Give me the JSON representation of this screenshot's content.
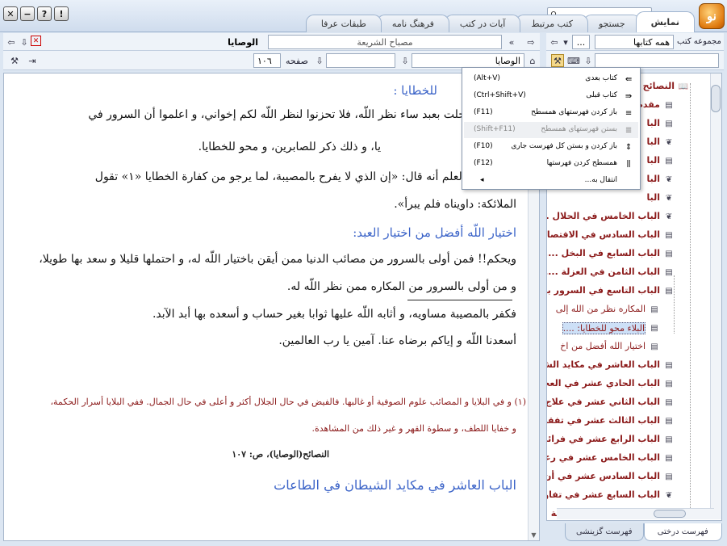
{
  "titlebar": {
    "tabs": [
      {
        "label": "نمایش",
        "active": true
      },
      {
        "label": "جستجو",
        "active": false
      },
      {
        "label": "کتب مرتبط",
        "active": false
      },
      {
        "label": "آیات در کتب",
        "active": false
      },
      {
        "label": "فرهنگ نامه",
        "active": false
      },
      {
        "label": "طبقات عرفا",
        "active": false
      }
    ],
    "logo_text": "نو"
  },
  "viewer_bar": {
    "book_title": "مصباح الشریعة",
    "section_title": "الوصايا",
    "section_field": "الوصايا",
    "page_label": "صفحه",
    "page_number": "١٠٦"
  },
  "library_bar": {
    "collection_label": "مجموعه کتب",
    "collection_value": "همه کتابها",
    "more": "..."
  },
  "text": {
    "heading_top": "للخطايا :",
    "lines": [
      "هذا مصيبة حلت بعبد ساء نظر اللّه، فلا تحزنوا لنظر اللّه لكم إخواني، و اعلموا أن السرور في",
      "يا، و ذلك ذكر للصابرين، و محو للخطايا.",
      "ن بعض أهل العلم أنه قال: «إن الذي لا يفرح بالمصيبة، لما يرجو من كفارة الخطايا «١» تقول",
      "الملائكة: داويناه فلم يبرأ»."
    ],
    "heading_2": "اختيار اللّه أفضل من اختيار العبد:",
    "lines_2": [
      "ويحكم!! فمن أولى بالسرور من مصائب الدنيا ممن أيقن باختيار اللّه له، و احتملها قليلا و سعد بها طويلا،",
      "و من أولى بالسرور من المكاره ممن نظر اللّه له.",
      "فكفر بالمصيبة مساويه، و أثابه اللّه عليها ثوابا بغير حساب و أسعده بها أبد الآبد.",
      "أسعدنا اللّه و إياكم برضاه عنا. آمين يا رب العالمين."
    ],
    "footnote_1": "(١) و في البلايا و المصائب علوم الصوفية أو غالبها. فالفيض في حال الجلال أكثر و أعلى في حال الجمال. ففي البلايا أسرار الحكمة،",
    "footnote_2": "و خفايا اللطف، و سطوة القهر و غير ذلك من المشاهدة.",
    "reference": "النصائح(الوصايا)، ص: ١٠٧",
    "next_heading": "الباب العاشر في مكايد الشيطان في الطاعات"
  },
  "context_menu": [
    {
      "label": "کتاب بعدی",
      "shortcut": "(Alt+V)",
      "icon": "book-next-icon",
      "disabled": false
    },
    {
      "label": "کتاب قبلی",
      "shortcut": "(Ctrl+Shift+V)",
      "icon": "book-prev-icon",
      "disabled": false
    },
    {
      "label": "باز کردن فهرستهای همسطح",
      "shortcut": "(F11)",
      "icon": "expand-level-icon",
      "disabled": false
    },
    {
      "label": "بستن فهرستهای همسطح",
      "shortcut": "(Shift+F11)",
      "icon": "collapse-level-icon",
      "disabled": true
    },
    {
      "label": "باز کردن و بستن کل فهرست جاری",
      "shortcut": "(F10)",
      "icon": "toggle-all-icon",
      "disabled": false
    },
    {
      "label": "همسطح کردن فهرستها",
      "shortcut": "(F12)",
      "icon": "flatten-icon",
      "disabled": false
    },
    {
      "label": "انتقال به...",
      "shortcut": "",
      "icon": "",
      "disabled": false,
      "submenu": true
    }
  ],
  "tree": {
    "nodes": [
      {
        "label": "النصائح",
        "level": 0,
        "icon": "book-open-icon"
      },
      {
        "label": "مقدم",
        "level": 1,
        "icon": "page-icon"
      },
      {
        "label": "البا",
        "level": 1,
        "icon": "page-icon"
      },
      {
        "label": "البا",
        "level": 1,
        "icon": "leaf-icon"
      },
      {
        "label": "البا",
        "level": 1,
        "icon": "page-icon"
      },
      {
        "label": "البا",
        "level": 1,
        "icon": "leaf-icon"
      },
      {
        "label": "البا",
        "level": 1,
        "icon": "leaf-icon"
      },
      {
        "label": "الباب الخامس في الحلال ..",
        "level": 1,
        "icon": "leaf-icon"
      },
      {
        "label": "الباب السادس في الاقتصاد",
        "level": 1,
        "icon": "page-icon"
      },
      {
        "label": "الباب السابع في البخل .....",
        "level": 1,
        "icon": "page-icon"
      },
      {
        "label": "الباب الثامن في العزلة .....",
        "level": 1,
        "icon": "page-icon"
      },
      {
        "label": "الباب التاسع في السرور به",
        "level": 1,
        "icon": "page-icon"
      },
      {
        "label": "المكاره نظر من الله إلى",
        "level": 2,
        "icon": "page-icon"
      },
      {
        "label": "البلاء محو للخطايا: ....",
        "level": 2,
        "icon": "page-icon",
        "selected": true
      },
      {
        "label": "اختيار الله أفضل من اخ",
        "level": 2,
        "icon": "page-icon"
      },
      {
        "label": "الباب العاشر في مكايد الش",
        "level": 1,
        "icon": "page-icon"
      },
      {
        "label": "الباب الحادي عشر في العجب",
        "level": 1,
        "icon": "page-icon"
      },
      {
        "label": "الباب الثاني عشر في علاج ا",
        "level": 1,
        "icon": "page-icon"
      },
      {
        "label": "الباب الثالث عشر في تفقد ا",
        "level": 1,
        "icon": "page-icon"
      },
      {
        "label": "الباب الرابع عشر في فرائض",
        "level": 1,
        "icon": "page-icon"
      },
      {
        "label": "الباب الخامس عشر في رعاي",
        "level": 1,
        "icon": "page-icon"
      },
      {
        "label": "الباب السادس عشر في أن ا",
        "level": 1,
        "icon": "page-icon"
      },
      {
        "label": "الباب السابع عشر في تفاوت",
        "level": 1,
        "icon": "leaf-icon"
      },
      {
        "label": "الباب الثامن عشر في نية ال",
        "level": 1,
        "icon": "leaf-icon"
      }
    ]
  },
  "bottom_tabs": [
    {
      "label": "فهرست درختی",
      "active": true
    },
    {
      "label": "فهرست گزینشی",
      "active": false
    }
  ]
}
